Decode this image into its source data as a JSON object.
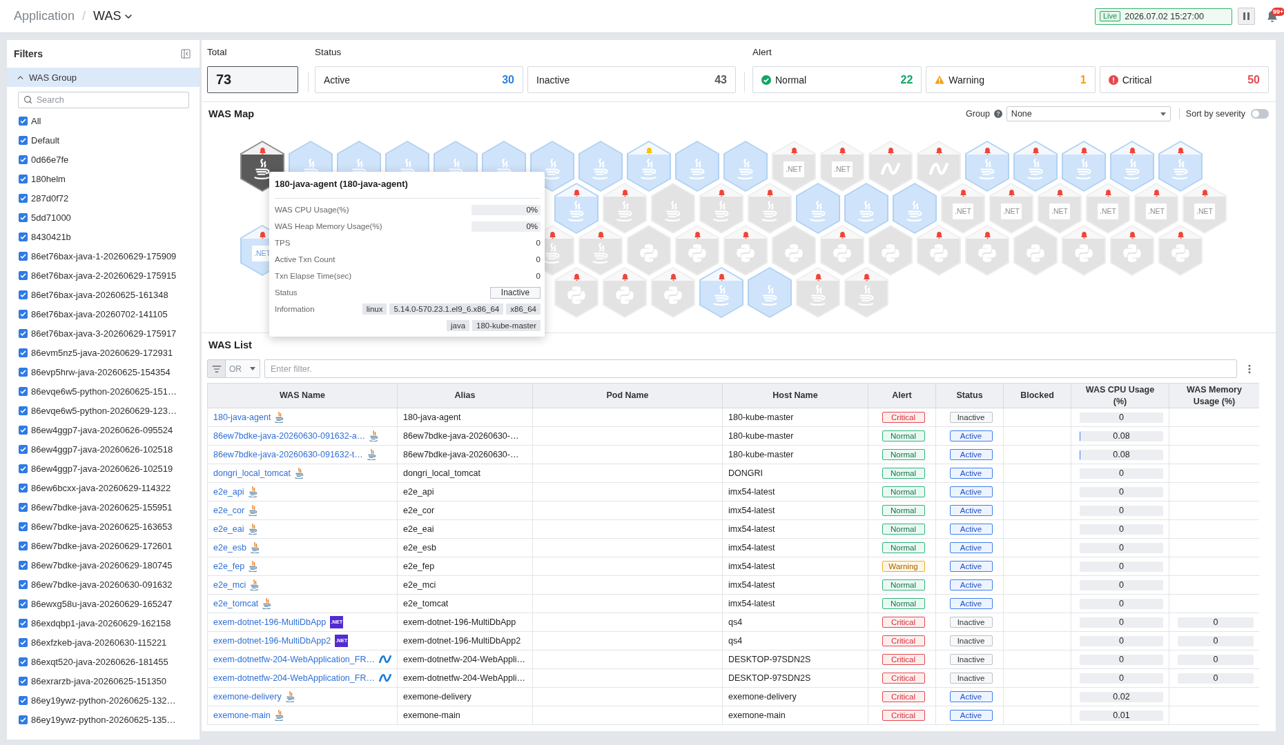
{
  "top_bar": {
    "breadcrumbs": [
      {
        "label": "Application",
        "current": false,
        "dropdown": false
      },
      {
        "label": "WAS",
        "current": true,
        "dropdown": true
      }
    ],
    "breadcrumb_separator": "/",
    "live": {
      "badge": "Live",
      "timestamp": "2026.07.02 15:27:00"
    },
    "notifications": {
      "badge": "99+"
    }
  },
  "sidebar": {
    "title": "Filters",
    "section": {
      "title": "WAS Group",
      "expanded": true,
      "search_placeholder": "Search",
      "items": [
        {
          "label": "All",
          "checked": true
        },
        {
          "label": "Default",
          "checked": true
        },
        {
          "label": "0d66e7fe",
          "checked": true
        },
        {
          "label": "180helm",
          "checked": true
        },
        {
          "label": "287d0f72",
          "checked": true
        },
        {
          "label": "5dd71000",
          "checked": true
        },
        {
          "label": "8430421b",
          "checked": true
        },
        {
          "label": "86et76bax-java-1-20260629-175909",
          "checked": true
        },
        {
          "label": "86et76bax-java-2-20260629-175915",
          "checked": true
        },
        {
          "label": "86et76bax-java-20260625-161348",
          "checked": true
        },
        {
          "label": "86et76bax-java-20260702-141105",
          "checked": true
        },
        {
          "label": "86et76bax-java-3-20260629-175917",
          "checked": true
        },
        {
          "label": "86evm5nz5-java-20260629-172931",
          "checked": true
        },
        {
          "label": "86evp5hrw-java-20260625-154354",
          "checked": true
        },
        {
          "label": "86evqe6w5-python-20260625-151…",
          "checked": true
        },
        {
          "label": "86evqe6w5-python-20260629-123…",
          "checked": true
        },
        {
          "label": "86ew4ggp7-java-20260626-095524",
          "checked": true
        },
        {
          "label": "86ew4ggp7-java-20260626-102518",
          "checked": true
        },
        {
          "label": "86ew4ggp7-java-20260626-102519",
          "checked": true
        },
        {
          "label": "86ew6bcxx-java-20260629-114322",
          "checked": true
        },
        {
          "label": "86ew7bdke-java-20260625-155951",
          "checked": true
        },
        {
          "label": "86ew7bdke-java-20260625-163653",
          "checked": true
        },
        {
          "label": "86ew7bdke-java-20260629-172601",
          "checked": true
        },
        {
          "label": "86ew7bdke-java-20260629-180745",
          "checked": true
        },
        {
          "label": "86ew7bdke-java-20260630-091632",
          "checked": true
        },
        {
          "label": "86ewxg58u-java-20260629-165247",
          "checked": true
        },
        {
          "label": "86exdqbp1-java-20260629-162158",
          "checked": true
        },
        {
          "label": "86exfzkeb-java-20260630-115221",
          "checked": true
        },
        {
          "label": "86exqt520-java-20260626-181455",
          "checked": true
        },
        {
          "label": "86exrarzb-java-20260625-151350",
          "checked": true
        },
        {
          "label": "86ey19ywz-python-20260625-132…",
          "checked": true
        },
        {
          "label": "86ey19ywz-python-20260625-135…",
          "checked": true
        }
      ]
    }
  },
  "summary": {
    "total": {
      "label": "Total",
      "count": "73"
    },
    "status": {
      "label": "Status",
      "cards": [
        {
          "label": "Active",
          "count": "30",
          "kind": "active"
        },
        {
          "label": "Inactive",
          "count": "43",
          "kind": "inactive"
        }
      ]
    },
    "alert": {
      "label": "Alert",
      "cards": [
        {
          "label": "Normal",
          "count": "22",
          "kind": "normal"
        },
        {
          "label": "Warning",
          "count": "1",
          "kind": "warning"
        },
        {
          "label": "Critical",
          "count": "50",
          "kind": "critical"
        }
      ]
    }
  },
  "was_map": {
    "title": "WAS Map",
    "group": {
      "label": "Group",
      "value": "None"
    },
    "sort_by_severity": {
      "label": "Sort by severity",
      "on": false
    },
    "rows": [
      {
        "hexes": [
          {
            "kind": "java",
            "active": false,
            "selected": true,
            "color": "#f04438"
          },
          {
            "kind": "java",
            "active": true,
            "selected": false
          },
          {
            "kind": "java",
            "active": true,
            "selected": false
          },
          {
            "kind": "java",
            "active": true,
            "selected": false
          },
          {
            "kind": "java",
            "active": true,
            "selected": false
          },
          {
            "kind": "java",
            "active": true,
            "selected": false
          },
          {
            "kind": "java",
            "active": true,
            "selected": false
          },
          {
            "kind": "java",
            "active": true,
            "selected": false
          },
          {
            "kind": "java",
            "active": true,
            "selected": false,
            "color": "#f5c400"
          },
          {
            "kind": "java",
            "active": true,
            "selected": false
          },
          {
            "kind": "java",
            "active": true,
            "selected": false
          },
          {
            "kind": "dotnet",
            "logo_text": ".NET",
            "active": false,
            "selected": false,
            "color": "#f04438"
          },
          {
            "kind": "dotnet",
            "logo_text": ".NET",
            "active": false,
            "selected": false,
            "color": "#f04438"
          },
          {
            "kind": "dotnetfw",
            "active": false,
            "selected": false,
            "color": "#f04438"
          },
          {
            "kind": "dotnetfw",
            "active": false,
            "selected": false,
            "color": "#f04438"
          },
          {
            "kind": "java",
            "active": true,
            "selected": false,
            "color": "#f04438"
          },
          {
            "kind": "java",
            "active": true,
            "selected": false,
            "color": "#f04438"
          },
          {
            "kind": "java",
            "active": true,
            "selected": false,
            "color": "#f04438"
          },
          {
            "kind": "java",
            "active": true,
            "selected": false,
            "color": "#f04438"
          },
          {
            "kind": "java",
            "active": true,
            "selected": false,
            "color": "#f04438"
          }
        ]
      },
      {
        "hexes": [
          {
            "kind": "covered"
          },
          {
            "kind": "covered"
          },
          {
            "kind": "covered"
          },
          {
            "kind": "covered"
          },
          {
            "kind": "covered"
          },
          {
            "kind": "covered"
          },
          {
            "kind": "java",
            "active": true,
            "selected": false,
            "color": "#f04438"
          },
          {
            "kind": "java",
            "active": false,
            "selected": false,
            "color": "#f04438"
          },
          {
            "kind": "java",
            "active": false,
            "selected": false
          },
          {
            "kind": "java",
            "active": false,
            "selected": false,
            "color": "#f04438"
          },
          {
            "kind": "java",
            "active": false,
            "selected": false,
            "color": "#f04438"
          },
          {
            "kind": "java",
            "active": true,
            "selected": false
          },
          {
            "kind": "java",
            "active": true,
            "selected": false
          },
          {
            "kind": "java",
            "active": true,
            "selected": false
          },
          {
            "kind": "dotnet",
            "logo_text": ".NET",
            "active": false,
            "selected": false,
            "color": "#f04438"
          },
          {
            "kind": "dotnet",
            "logo_text": ".NET",
            "active": false,
            "selected": false,
            "color": "#f04438"
          },
          {
            "kind": "dotnet",
            "logo_text": ".NET",
            "active": false,
            "selected": false,
            "color": "#f04438"
          },
          {
            "kind": "dotnet",
            "logo_text": ".NET",
            "active": false,
            "selected": false,
            "color": "#f04438"
          },
          {
            "kind": "dotnet",
            "logo_text": ".NET",
            "active": false,
            "selected": false,
            "color": "#f04438"
          },
          {
            "kind": "dotnet",
            "logo_text": ".NET",
            "active": false,
            "selected": false,
            "color": "#f04438"
          }
        ]
      },
      {
        "hexes": [
          {
            "kind": "dotnet",
            "logo_text": ".NET",
            "active": true,
            "selected": false,
            "color": "#f04438"
          },
          {
            "kind": "covered"
          },
          {
            "kind": "covered"
          },
          {
            "kind": "covered"
          },
          {
            "kind": "covered"
          },
          {
            "kind": "covered"
          },
          {
            "kind": "java",
            "active": false,
            "selected": false,
            "color": "#f04438"
          },
          {
            "kind": "java",
            "active": false,
            "selected": false,
            "color": "#f04438"
          },
          {
            "kind": "python",
            "active": false,
            "selected": false
          },
          {
            "kind": "python",
            "active": false,
            "selected": false,
            "color": "#f04438"
          },
          {
            "kind": "python",
            "active": false,
            "selected": false,
            "color": "#f04438"
          },
          {
            "kind": "python",
            "active": false,
            "selected": false
          },
          {
            "kind": "python",
            "active": false,
            "selected": false,
            "color": "#f04438"
          },
          {
            "kind": "python",
            "active": false,
            "selected": false
          },
          {
            "kind": "python",
            "active": false,
            "selected": false,
            "color": "#f04438"
          },
          {
            "kind": "python",
            "active": false,
            "selected": false,
            "color": "#f04438"
          },
          {
            "kind": "python",
            "active": false,
            "selected": false
          },
          {
            "kind": "python",
            "active": false,
            "selected": false,
            "color": "#f04438"
          },
          {
            "kind": "python",
            "active": false,
            "selected": false,
            "color": "#f04438"
          },
          {
            "kind": "python",
            "active": false,
            "selected": false,
            "color": "#f04438"
          }
        ]
      },
      {
        "hexes": [
          {
            "kind": "covered"
          },
          {
            "kind": "covered"
          },
          {
            "kind": "covered"
          },
          {
            "kind": "covered"
          },
          {
            "kind": "covered"
          },
          {
            "kind": "covered"
          },
          {
            "kind": "python",
            "active": false,
            "selected": false,
            "color": "#f04438"
          },
          {
            "kind": "python",
            "active": false,
            "selected": false,
            "color": "#f04438"
          },
          {
            "kind": "python",
            "active": false,
            "selected": false,
            "color": "#f04438"
          },
          {
            "kind": "java",
            "active": true,
            "selected": false,
            "color": "#f04438"
          },
          {
            "kind": "java",
            "active": true,
            "selected": false
          },
          {
            "kind": "java",
            "active": false,
            "selected": false,
            "color": "#f04438"
          },
          {
            "kind": "java",
            "active": false,
            "selected": false,
            "color": "#f04438"
          }
        ]
      }
    ],
    "tooltip": {
      "title": "180-java-agent (180-java-agent)",
      "metrics": [
        {
          "kind": "bar",
          "label": "WAS CPU Usage(%)",
          "value": "0%"
        },
        {
          "kind": "bar",
          "label": "WAS Heap Memory Usage(%)",
          "value": "0%"
        },
        {
          "kind": "number",
          "label": "TPS",
          "value": "0"
        },
        {
          "kind": "number",
          "label": "Active Txn Count",
          "value": "0"
        },
        {
          "kind": "number",
          "label": "Txn Elapse Time(sec)",
          "value": "0"
        },
        {
          "kind": "status",
          "label": "Status",
          "value": "Inactive",
          "active": false
        },
        {
          "kind": "tags",
          "label": "Information",
          "tags": [
            "linux",
            "5.14.0-570.23.1.el9_6.x86_64",
            "x86_64",
            "java",
            "180-kube-master"
          ]
        }
      ]
    }
  },
  "was_list": {
    "title": "WAS List",
    "filter": {
      "operator": "OR",
      "placeholder": "Enter filter."
    },
    "columns": [
      "WAS Name",
      "Alias",
      "Pod Name",
      "Host Name",
      "Alert",
      "Status",
      "Blocked",
      "WAS CPU Usage (%)",
      "WAS Memory Usage (%)"
    ],
    "rows": [
      {
        "name": "180-java-agent",
        "kind": "java",
        "alias": "180-java-agent",
        "host": "180-kube-master",
        "alert": {
          "label": "Critical",
          "kind": "critical"
        },
        "status": "Inactive",
        "active": false,
        "cpu": {
          "value": "0"
        }
      },
      {
        "name": "86ew7bdke-java-20260630-091632-a…",
        "kind": "java",
        "alias": "86ew7bdke-java-20260630-…",
        "host": "180-kube-master",
        "alert": {
          "label": "Normal",
          "kind": "normal"
        },
        "status": "Active",
        "active": true,
        "cpu": {
          "value": "0.08",
          "level": 0.01
        }
      },
      {
        "name": "86ew7bdke-java-20260630-091632-t…",
        "kind": "java",
        "alias": "86ew7bdke-java-20260630-…",
        "host": "180-kube-master",
        "alert": {
          "label": "Normal",
          "kind": "normal"
        },
        "status": "Active",
        "active": true,
        "cpu": {
          "value": "0.08",
          "level": 0.01
        }
      },
      {
        "name": "dongri_local_tomcat",
        "kind": "java",
        "alias": "dongri_local_tomcat",
        "host": "DONGRI",
        "alert": {
          "label": "Normal",
          "kind": "normal"
        },
        "status": "Active",
        "active": true,
        "cpu": {
          "value": "0"
        }
      },
      {
        "name": "e2e_api",
        "kind": "java",
        "alias": "e2e_api",
        "host": "imx54-latest",
        "alert": {
          "label": "Normal",
          "kind": "normal"
        },
        "status": "Active",
        "active": true,
        "cpu": {
          "value": "0"
        }
      },
      {
        "name": "e2e_cor",
        "kind": "java",
        "alias": "e2e_cor",
        "host": "imx54-latest",
        "alert": {
          "label": "Normal",
          "kind": "normal"
        },
        "status": "Active",
        "active": true,
        "cpu": {
          "value": "0"
        }
      },
      {
        "name": "e2e_eai",
        "kind": "java",
        "alias": "e2e_eai",
        "host": "imx54-latest",
        "alert": {
          "label": "Normal",
          "kind": "normal"
        },
        "status": "Active",
        "active": true,
        "cpu": {
          "value": "0"
        }
      },
      {
        "name": "e2e_esb",
        "kind": "java",
        "alias": "e2e_esb",
        "host": "imx54-latest",
        "alert": {
          "label": "Normal",
          "kind": "normal"
        },
        "status": "Active",
        "active": true,
        "cpu": {
          "value": "0"
        }
      },
      {
        "name": "e2e_fep",
        "kind": "java",
        "alias": "e2e_fep",
        "host": "imx54-latest",
        "alert": {
          "label": "Warning",
          "kind": "warning"
        },
        "status": "Active",
        "active": true,
        "cpu": {
          "value": "0"
        }
      },
      {
        "name": "e2e_mci",
        "kind": "java",
        "alias": "e2e_mci",
        "host": "imx54-latest",
        "alert": {
          "label": "Normal",
          "kind": "normal"
        },
        "status": "Active",
        "active": true,
        "cpu": {
          "value": "0"
        }
      },
      {
        "name": "e2e_tomcat",
        "kind": "java",
        "alias": "e2e_tomcat",
        "host": "imx54-latest",
        "alert": {
          "label": "Normal",
          "kind": "normal"
        },
        "status": "Active",
        "active": true,
        "cpu": {
          "value": "0"
        }
      },
      {
        "name": "exem-dotnet-196-MultiDbApp",
        "kind": "dotnet",
        "logo_text": ".NET",
        "alias": "exem-dotnet-196-MultiDbApp",
        "host": "qs4",
        "alert": {
          "label": "Critical",
          "kind": "critical"
        },
        "status": "Inactive",
        "active": false,
        "cpu": {
          "value": "0"
        },
        "memory": {
          "value": "0"
        }
      },
      {
        "name": "exem-dotnet-196-MultiDbApp2",
        "kind": "dotnet",
        "logo_text": ".NET",
        "alias": "exem-dotnet-196-MultiDbApp2",
        "host": "qs4",
        "alert": {
          "label": "Critical",
          "kind": "critical"
        },
        "status": "Inactive",
        "active": false,
        "cpu": {
          "value": "0"
        },
        "memory": {
          "value": "0"
        }
      },
      {
        "name": "exem-dotnetfw-204-WebApplication_FR…",
        "kind": "dotnetfw",
        "alias": "exem-dotnetfw-204-WebAppli…",
        "host": "DESKTOP-97SDN2S",
        "alert": {
          "label": "Critical",
          "kind": "critical"
        },
        "status": "Inactive",
        "active": false,
        "cpu": {
          "value": "0"
        },
        "memory": {
          "value": "0"
        }
      },
      {
        "name": "exem-dotnetfw-204-WebApplication_FR…",
        "kind": "dotnetfw",
        "alias": "exem-dotnetfw-204-WebAppli…",
        "host": "DESKTOP-97SDN2S",
        "alert": {
          "label": "Critical",
          "kind": "critical"
        },
        "status": "Inactive",
        "active": false,
        "cpu": {
          "value": "0"
        },
        "memory": {
          "value": "0"
        }
      },
      {
        "name": "exemone-delivery",
        "kind": "java",
        "alias": "exemone-delivery",
        "host": "exemone-delivery",
        "alert": {
          "label": "Critical",
          "kind": "critical"
        },
        "status": "Active",
        "active": true,
        "cpu": {
          "value": "0.02"
        }
      },
      {
        "name": "exemone-main",
        "kind": "java",
        "alias": "exemone-main",
        "host": "exemone-main",
        "alert": {
          "label": "Critical",
          "kind": "critical"
        },
        "status": "Active",
        "active": true,
        "cpu": {
          "value": "0.01"
        }
      }
    ]
  }
}
